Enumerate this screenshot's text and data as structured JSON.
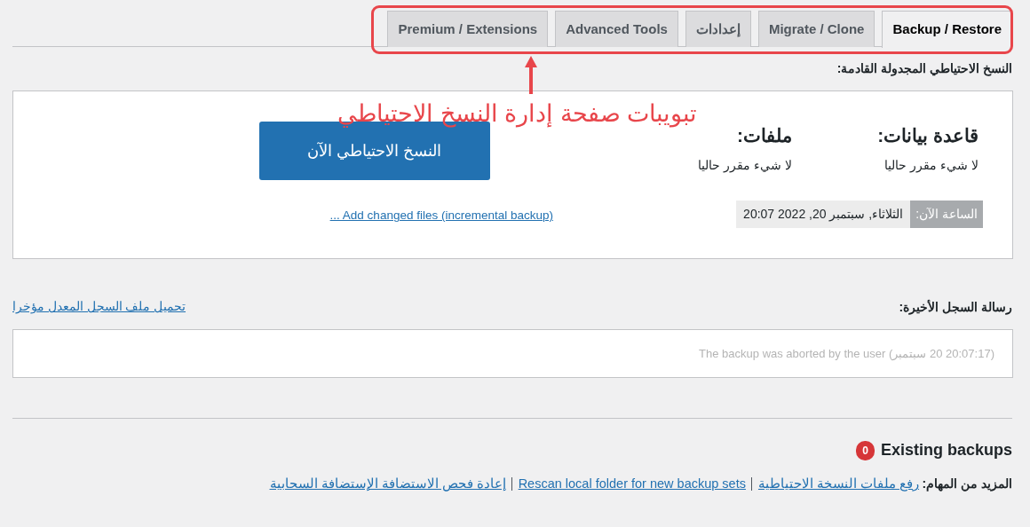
{
  "tabs": [
    {
      "label": "Backup / Restore",
      "selected": true
    },
    {
      "label": "Migrate / Clone",
      "selected": false
    },
    {
      "label": "إعدادات",
      "selected": false
    },
    {
      "label": "Advanced Tools",
      "selected": false
    },
    {
      "label": "Premium / Extensions",
      "selected": false
    }
  ],
  "annotation": {
    "text": "تبويبات صفحة إدارة النسخ الاحتياطي"
  },
  "scheduled": {
    "heading": "النسخ الاحتياطي المجدولة القادمة:",
    "database": {
      "label": "قاعدة بيانات:",
      "value": "لا شيء مقرر حاليا"
    },
    "files": {
      "label": "ملفات:",
      "value": "لا شيء مقرر حاليا"
    },
    "time_label": "الساعة الآن:",
    "time_value": "الثلاثاء, سبتمبر 20, 2022 20:07",
    "backup_button": "النسخ الاحتياطي الآن",
    "incremental_link": "... Add changed files (incremental backup)"
  },
  "log": {
    "heading": "رسالة السجل الأخيرة:",
    "download_link": "تحميل ملف السجل المعدل مؤخرا",
    "message": "(20:07:17 20 سبتمبر) The backup was aborted by the user"
  },
  "existing": {
    "heading": "Existing backups",
    "count": "0"
  },
  "more_tasks": {
    "label": "المزيد من المهام:",
    "links": [
      "رفع ملفات النسخة الاحتياطية",
      "Rescan local folder for new backup sets",
      "إعادة فحص الاستضافة الإستضافة السحابية"
    ]
  }
}
